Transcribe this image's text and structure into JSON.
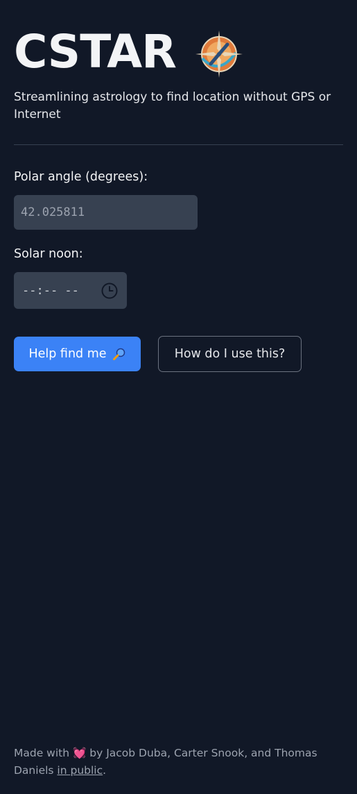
{
  "header": {
    "title": "CSTAR",
    "logo_icon": "compass-icon",
    "subtitle": "Streamlining astrology to find location without GPS or Internet"
  },
  "form": {
    "polar_label": "Polar angle (degrees):",
    "polar_placeholder": "42.025811",
    "noon_label": "Solar noon:",
    "noon_value": "--:-- --",
    "noon_icon": "clock-icon"
  },
  "actions": {
    "primary_label": "Help find me",
    "primary_icon": "magnifier-icon",
    "secondary_label": "How do I use this?"
  },
  "footer": {
    "made_with": "Made with",
    "heart": "💓",
    "authors": "by Jacob Duba, Carter Snook, and Thomas Daniels",
    "link_text": "in public",
    "period": "."
  },
  "colors": {
    "background": "#111827",
    "primary": "#3b82f6",
    "input_bg": "#374151"
  }
}
